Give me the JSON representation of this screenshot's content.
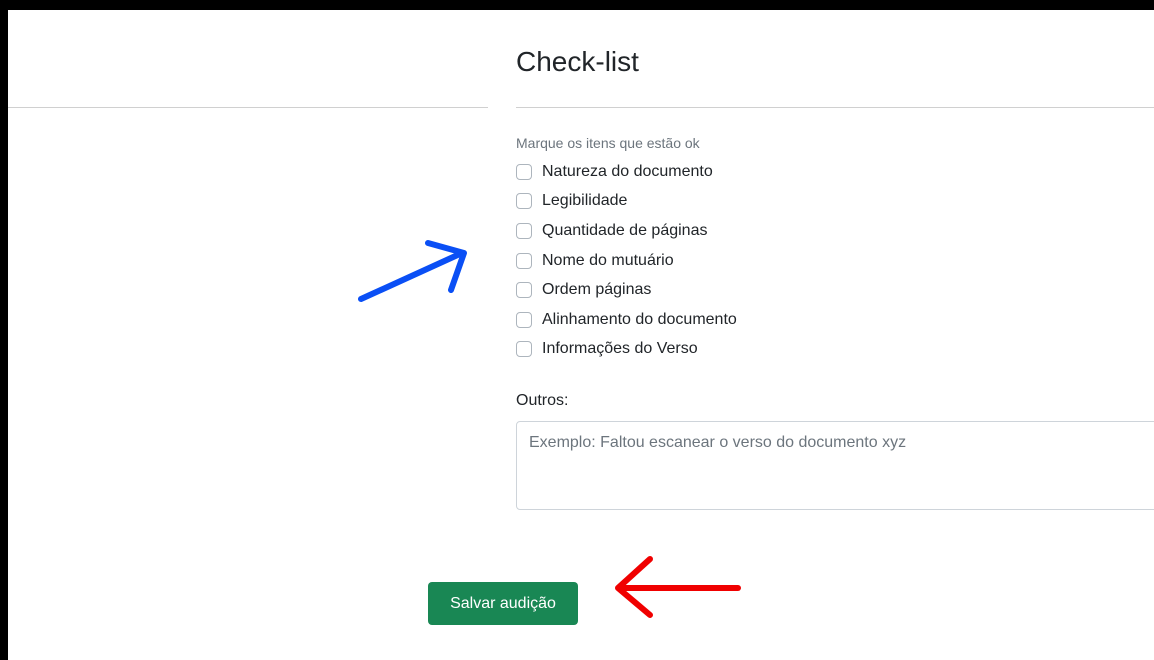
{
  "page": {
    "title": "Check-list"
  },
  "checklist": {
    "hint": "Marque os itens que estão ok",
    "items": [
      {
        "label": "Natureza do documento",
        "checked": false
      },
      {
        "label": "Legibilidade",
        "checked": false
      },
      {
        "label": "Quantidade de páginas",
        "checked": false
      },
      {
        "label": "Nome do mutuário",
        "checked": false
      },
      {
        "label": "Ordem páginas",
        "checked": false
      },
      {
        "label": "Alinhamento do documento",
        "checked": false
      },
      {
        "label": "Informações do Verso",
        "checked": false
      }
    ]
  },
  "outros": {
    "label": "Outros:",
    "placeholder": "Exemplo: Faltou escanear o verso do documento xyz",
    "value": ""
  },
  "actions": {
    "save_label": "Salvar audição"
  },
  "colors": {
    "save_button_bg": "#198754",
    "annotation_blue": "#0a4ff5",
    "annotation_red": "#f00000"
  }
}
